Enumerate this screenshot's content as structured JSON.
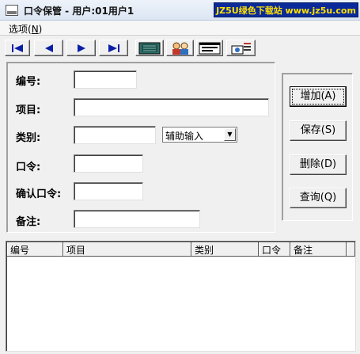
{
  "window": {
    "title": "口令保管 - 用户:01用户1",
    "watermark": "JZ5U绿色下载站 www.jz5u.com"
  },
  "menu": {
    "items": [
      {
        "label": "选项(",
        "mnemonic": "N",
        "suffix": ")"
      }
    ]
  },
  "toolbar": {
    "nav_first": "first-record-icon",
    "nav_prev": "previous-record-icon",
    "nav_next": "next-record-icon",
    "nav_last": "last-record-icon",
    "tools": [
      "database-icon",
      "users-icon",
      "window-list-icon",
      "settings-icon"
    ]
  },
  "form": {
    "number_label": "编号:",
    "item_label": "项目:",
    "category_label": "类别:",
    "password_label": "口令:",
    "confirm_label": "确认口令:",
    "remark_label": "备注:",
    "category_select": "辅助输入"
  },
  "buttons": {
    "add": "增加(A)",
    "save": "保存(S)",
    "delete": "删除(D)",
    "query": "查询(Q)"
  },
  "table": {
    "columns": [
      "编号",
      "项目",
      "类别",
      "口令",
      "备注"
    ],
    "rows": []
  },
  "colors": {
    "nav_arrow": "#0a1fa8",
    "watermark_bg": "#0a2a9a",
    "watermark_text": "#ffe000"
  }
}
